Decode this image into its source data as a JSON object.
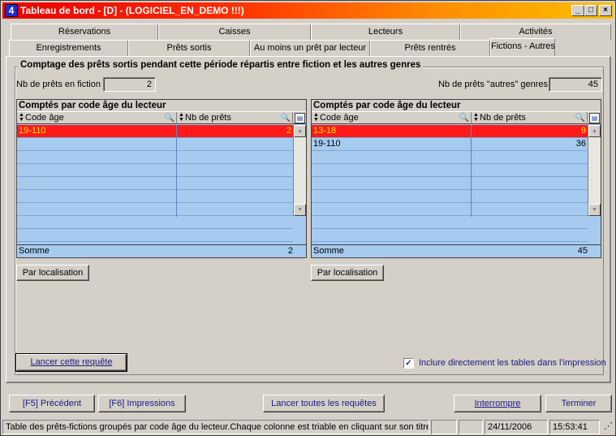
{
  "window": {
    "title": "Tableau de bord  - [D] - (LOGICIEL_EN_DEMO !!!)",
    "app_icon_glyph": "4",
    "buttons": {
      "minimize": "_",
      "maximize": "□",
      "close": "×"
    }
  },
  "tabs_row1": [
    "Réservations",
    "Caisses",
    "Lecteurs",
    "Activités"
  ],
  "tabs_row2": [
    "Enregistrements",
    "Prêts sortis",
    "Au moins un prêt par lecteur",
    "Prêts rentrés",
    "Fictions - Autres"
  ],
  "active_tab": "Fictions - Autres",
  "group": {
    "title": "Comptage des prêts sortis pendant cette période répartis entre fiction et les autres genres",
    "fiction_label": "Nb de prêts en fiction",
    "fiction_value": "2",
    "autres_label": "Nb de prêts \"autres\" genres",
    "autres_value": "45"
  },
  "table_left": {
    "title": "Comptés par code âge du lecteur",
    "headers": [
      "Code âge",
      "Nb de prêts"
    ],
    "rows": [
      {
        "code": "19-110",
        "nb": "2",
        "selected": true
      }
    ],
    "empty_rows": 8,
    "sum_label": "Somme",
    "sum_value": "2",
    "button": "Par localisation"
  },
  "table_right": {
    "title": "Comptés par code âge du lecteur",
    "headers": [
      "Code âge",
      "Nb de prêts"
    ],
    "rows": [
      {
        "code": "13-18",
        "nb": "9",
        "selected": true
      },
      {
        "code": "19-110",
        "nb": "36",
        "selected": false
      }
    ],
    "empty_rows": 7,
    "sum_label": "Somme",
    "sum_value": "45",
    "button": "Par localisation"
  },
  "run_query_button": "Lancer cette requête",
  "include_tables": {
    "label": "Inclure directement les tables dans l'impression",
    "checked": true,
    "mark": "✓"
  },
  "bottom_buttons": {
    "previous": "[F5] Précédent",
    "prints": "[F6] Impressions",
    "run_all": "Lancer toutes les requêtes",
    "interrupt": "Interrompre",
    "finish": "Terminer"
  },
  "status": {
    "message": "Table des prêts-fictions groupés par code âge du lecteur.Chaque colonne est triable en cliquant sur son titre",
    "date": "24/11/2006",
    "time": "15:53:41"
  },
  "colors": {
    "selected_row": "#ff1a1a",
    "selected_text": "#ffe400",
    "table_bg": "#a6cbef"
  }
}
